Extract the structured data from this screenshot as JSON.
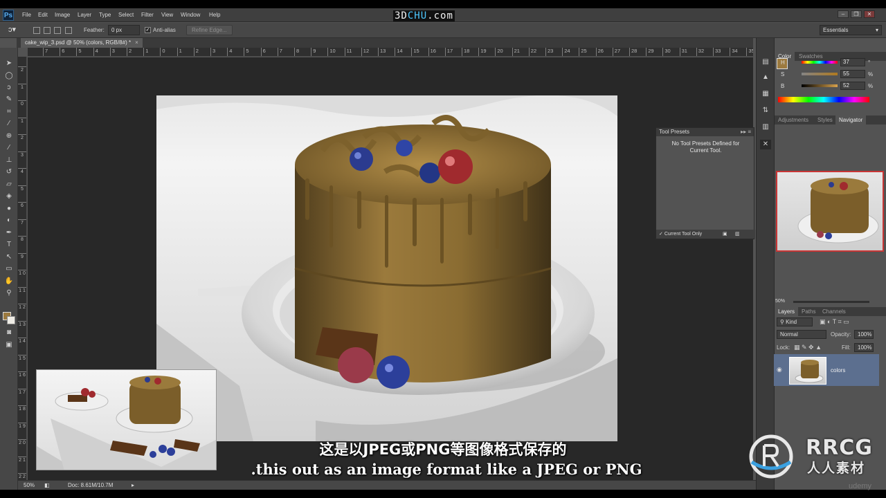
{
  "menubar": {
    "logo": "Ps",
    "items": [
      "File",
      "Edit",
      "Image",
      "Layer",
      "Type",
      "Select",
      "Filter",
      "View",
      "Window",
      "Help"
    ],
    "watermark_a": "3D",
    "watermark_b": "CHU",
    "watermark_c": ".com",
    "window_buttons": [
      "–",
      "❐",
      "✕"
    ]
  },
  "options": {
    "feather_label": "Feather:",
    "feather_value": "0 px",
    "antialias_label": "Anti-alias",
    "antialias_checked": true,
    "refine_edge": "Refine Edge...",
    "workspace": "Essentials"
  },
  "document": {
    "tab_title": "cake_wip_3.psd @ 50% (colors, RGB/8#) *",
    "close": "×"
  },
  "rulers": {
    "top": [
      "7",
      "6",
      "5",
      "4",
      "3",
      "2",
      "1",
      "0",
      "1",
      "2",
      "3",
      "4",
      "5",
      "6",
      "7",
      "8",
      "9",
      "10",
      "11",
      "12",
      "13",
      "14",
      "15",
      "16",
      "17",
      "18",
      "19",
      "20",
      "21",
      "22",
      "23",
      "24",
      "25",
      "26",
      "27",
      "28",
      "29",
      "30",
      "31",
      "32",
      "33",
      "34",
      "35"
    ],
    "left": [
      "2",
      "1",
      "0",
      "1",
      "2",
      "3",
      "4",
      "5",
      "6",
      "7",
      "8",
      "9",
      "1 0",
      "1 1",
      "1 2",
      "1 3",
      "1 4",
      "1 5",
      "1 6",
      "1 7",
      "1 8",
      "1 9",
      "2 0",
      "2 1",
      "2 2"
    ]
  },
  "tool_presets": {
    "title": "Tool Presets",
    "message": "No Tool Presets Defined for Current Tool.",
    "footer": "Current Tool Only"
  },
  "color_panel": {
    "tabs": [
      "Color",
      "Swatches"
    ],
    "h_label": "H",
    "h_value": "37",
    "s_label": "S",
    "s_value": "55",
    "b_label": "B",
    "b_value": "52",
    "degree": "°",
    "pct": "%",
    "foreground": "#9c7a3f"
  },
  "nav_panel": {
    "tabs": [
      "Adjustments",
      "Styles",
      "Navigator"
    ],
    "zoom": "50%"
  },
  "layers_panel": {
    "tabs": [
      "Layers",
      "Paths",
      "Channels"
    ],
    "kind": "Kind",
    "blend_mode": "Normal",
    "opacity_label": "Opacity:",
    "opacity_value": "100%",
    "lock_label": "Lock:",
    "fill_label": "Fill:",
    "fill_value": "100%",
    "layer_name": "colors"
  },
  "status": {
    "zoom": "50%",
    "doc": "Doc: 8.61M/10.7M"
  },
  "subtitles": {
    "cn": "这是以JPEG或PNG等图像格式保存的",
    "en": ".this out as an image format like a JPEG or PNG"
  },
  "brand": {
    "name": "RRCG",
    "cn": "人人素材",
    "udemy": "udemy"
  }
}
